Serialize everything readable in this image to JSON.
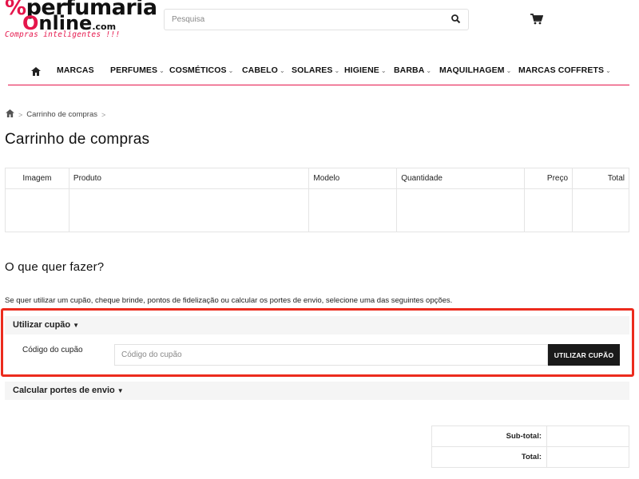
{
  "brand": {
    "logo_top": "perfumaria",
    "logo_bottom": "nline",
    "logo_suffix": ".com",
    "slogan": "Compras inteligentes !!!",
    "accent_color": "#e5154b"
  },
  "search": {
    "placeholder": "Pesquisa",
    "value": "",
    "button_icon": "search-icon"
  },
  "header": {
    "cart_icon": "cart-icon"
  },
  "nav": {
    "home_icon": "home-icon",
    "items": [
      {
        "label": "MARCAS",
        "has_dropdown": false
      },
      {
        "label": "PERFUMES",
        "has_dropdown": true
      },
      {
        "label": "COSMÉTICOS",
        "has_dropdown": true
      },
      {
        "label": "CABELO",
        "has_dropdown": true
      },
      {
        "label": "SOLARES",
        "has_dropdown": true
      },
      {
        "label": "HIGIENE",
        "has_dropdown": true
      },
      {
        "label": "BARBA",
        "has_dropdown": true
      },
      {
        "label": "MAQUILHAGEM",
        "has_dropdown": true
      },
      {
        "label": "MARCAS COFFRETS",
        "has_dropdown": true
      }
    ]
  },
  "breadcrumb": {
    "home_icon": "home-icon",
    "items": [
      "Carrinho de compras"
    ]
  },
  "page": {
    "title": "Carrinho de compras"
  },
  "cart_table": {
    "headers": [
      "Imagem",
      "Produto",
      "Modelo",
      "Quantidade",
      "Preço",
      "Total"
    ],
    "rows": [
      [
        "",
        "",
        "",
        "",
        "",
        ""
      ]
    ]
  },
  "options": {
    "title": "O que quer fazer?",
    "description": "Se quer utilizar um cupão, cheque brinde, pontos de fidelização ou calcular os portes de envio, selecione uma das seguintes opções.",
    "coupon": {
      "heading": "Utilizar cupão",
      "label": "Código do cupão",
      "placeholder": "Código do cupão",
      "value": "",
      "button": "UTILIZAR CUPÃO",
      "highlight_color": "#ec2b1d"
    },
    "shipping": {
      "heading": "Calcular portes de envio"
    }
  },
  "totals": {
    "rows": [
      {
        "label": "Sub-total:",
        "value": ""
      },
      {
        "label": "Total:",
        "value": ""
      }
    ]
  }
}
